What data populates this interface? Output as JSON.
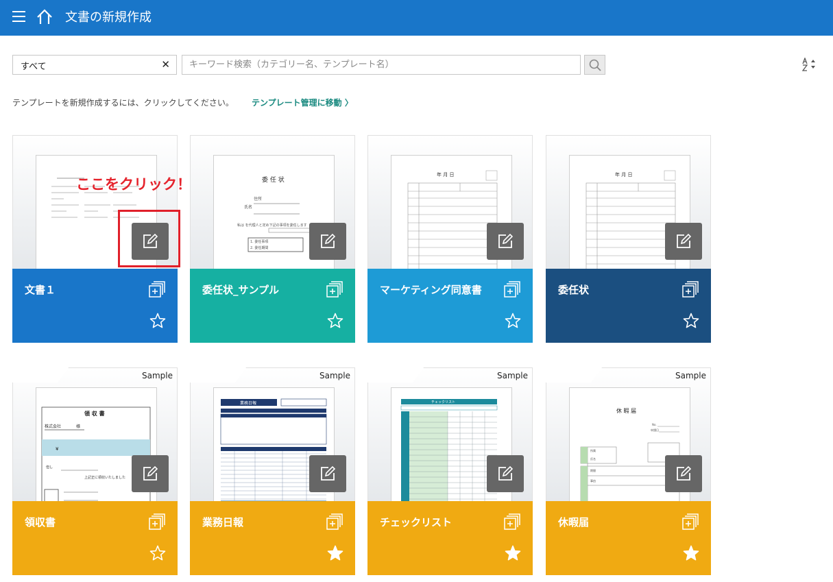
{
  "header": {
    "title": "文書の新規作成",
    "menu_icon": "hamburger-menu-icon",
    "home_icon": "home-icon",
    "background": "#1976c9"
  },
  "filter": {
    "value": "すべて",
    "clear_label": "✕"
  },
  "search": {
    "placeholder": "キーワード検索（カテゴリー名、テンプレート名）",
    "icon": "search-icon"
  },
  "sort": {
    "icon": "sort-az-icon"
  },
  "hint": {
    "text": "テンプレートを新規作成するには、クリックしてください。",
    "link_label": "テンプレート管理に移動 〉"
  },
  "annotation": {
    "text": "ここをクリック！",
    "color": "#e5232c"
  },
  "templates": [
    {
      "name": "文書１",
      "color": "#1976c9",
      "sample": false,
      "favorite": false
    },
    {
      "name": "委任状_サンプル",
      "color": "#16b0a2",
      "sample": false,
      "favorite": false
    },
    {
      "name": "マーケティング同意書",
      "color": "#1e9bd6",
      "sample": false,
      "favorite": false
    },
    {
      "name": "委任状",
      "color": "#1b4f80",
      "sample": false,
      "favorite": false
    },
    {
      "name": "領収書",
      "color": "#f0aa12",
      "sample": true,
      "sample_label": "Sample",
      "favorite": false
    },
    {
      "name": "業務日報",
      "color": "#f0aa12",
      "sample": true,
      "sample_label": "Sample",
      "favorite": true
    },
    {
      "name": "チェックリスト",
      "color": "#f0aa12",
      "sample": true,
      "sample_label": "Sample",
      "favorite": true
    },
    {
      "name": "休暇届",
      "color": "#f0aa12",
      "sample": true,
      "sample_label": "Sample",
      "favorite": true
    }
  ],
  "previews": [
    {
      "heading": "",
      "lines": [
        "",
        "",
        "",
        ""
      ]
    },
    {
      "heading": "委 任 状",
      "lines": [
        "住所",
        "氏名",
        "私は  を代理人と定め下記の事項を委任します",
        "1. 委任事項",
        "2. 委任期間"
      ]
    },
    {
      "heading": "年 月 日",
      "lines": [
        "",
        "",
        ""
      ]
    },
    {
      "heading": "年 月 日",
      "lines": [
        "",
        "",
        ""
      ]
    },
    {
      "heading": "領 収 書",
      "lines": [
        "株式会社",
        "様",
        "¥",
        "但し",
        "上記正に領収いたしました"
      ]
    },
    {
      "heading": "業務日報",
      "lines": [
        "",
        ""
      ]
    },
    {
      "heading": "チェックリスト",
      "lines": [
        ""
      ]
    },
    {
      "heading": "休 暇 届",
      "lines": [
        "No.",
        "申請日",
        "所属",
        "氏名",
        "期間",
        "事由"
      ]
    }
  ]
}
